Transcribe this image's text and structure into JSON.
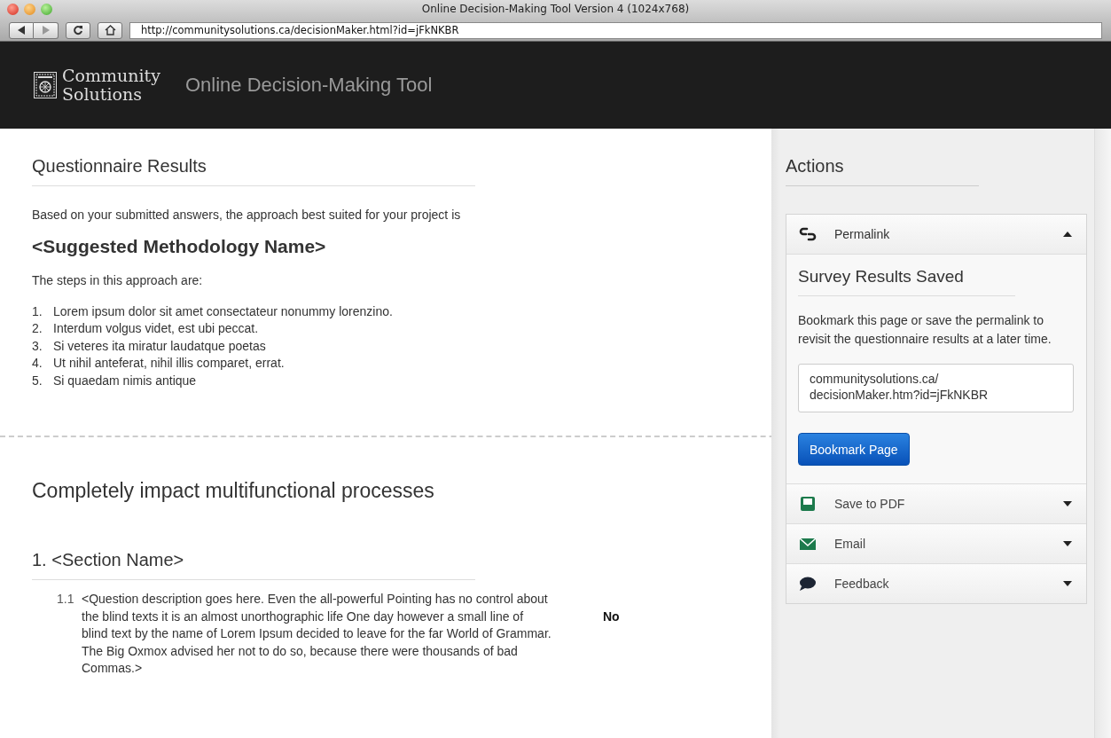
{
  "window": {
    "title": "Online Decision-Making Tool Version 4 (1024x768)",
    "url": "http://communitysolutions.ca/decisionMaker.html?id=jFkNKBR"
  },
  "header": {
    "brand_lines": [
      "Community",
      "Solutions"
    ],
    "app_title": "Online Decision-Making Tool"
  },
  "results": {
    "heading": "Questionnaire Results",
    "intro": "Based on your submitted answers, the approach best suited for your project is",
    "methodology": "<Suggested Methodology Name>",
    "steps_intro": "The steps in this approach are:",
    "steps": [
      {
        "number": "1.",
        "text": "Lorem ipsum dolor sit amet consectateur nonummy lorenzino."
      },
      {
        "number": "2.",
        "text": "Interdum volgus videt, est ubi peccat."
      },
      {
        "number": "3.",
        "text": "Si veteres ita miratur laudatque poetas"
      },
      {
        "number": "4.",
        "text": "Ut nihil anteferat, nihil illis comparet, errat."
      },
      {
        "number": "5.",
        "text": "Si quaedam nimis antique"
      }
    ]
  },
  "section": {
    "heading": "Completely impact multifunctional processes",
    "subsection": "1. <Section Name>",
    "questions": [
      {
        "number": "1.1",
        "text": "<Question description goes here. Even the all-powerful Pointing has no control about the blind texts it is an almost unorthographic life One day however a small line of blind text by the name of Lorem Ipsum decided to leave for the far World of Grammar. The Big Oxmox advised her not to do so, because there were thousands of bad Commas.>",
        "answer": "No"
      }
    ]
  },
  "actions": {
    "heading": "Actions",
    "panels": [
      {
        "kind": "link",
        "label": "Permalink",
        "expanded": true,
        "body": {
          "title": "Survey Results Saved",
          "text": "Bookmark this page or save the permalink to revisit the questionnaire results at a later time.",
          "link_value": "communitysolutions.ca/\ndecisionMaker.htm?id=jFkNKBR",
          "button": "Bookmark Page"
        }
      },
      {
        "kind": "save",
        "label": "Save to PDF",
        "expanded": false
      },
      {
        "kind": "email",
        "label": "Email",
        "expanded": false
      },
      {
        "kind": "feedback",
        "label": "Feedback",
        "expanded": false
      }
    ]
  }
}
